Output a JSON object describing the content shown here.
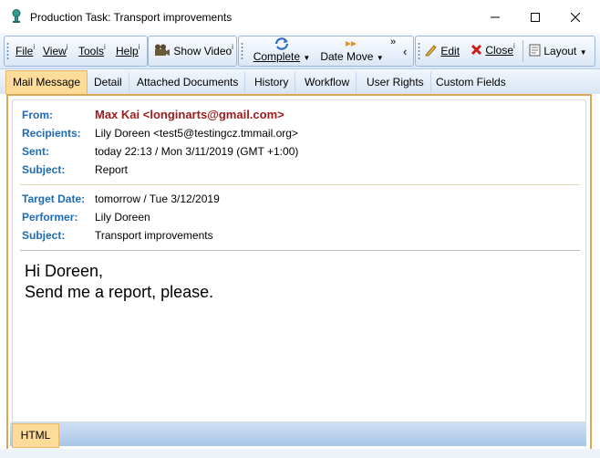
{
  "window": {
    "title": "Production Task: Transport improvements",
    "app_icon": "pin-icon",
    "controls": {
      "minimize": "—",
      "maximize": "☐",
      "close": "✕"
    }
  },
  "toolbar": {
    "file": "File",
    "view": "View",
    "tools": "Tools",
    "help": "Help",
    "info_mark": "i",
    "show_video": "Show Video",
    "complete": "Complete",
    "date_move": "Date Move",
    "edit": "Edit",
    "close": "Close",
    "layout": "Layout",
    "overflow": "»",
    "collapse": "‹"
  },
  "tabs": [
    "Mail Message",
    "Detail",
    "Attached Documents",
    "History",
    "Workflow",
    "User Rights",
    "Custom Fields"
  ],
  "active_tab": "Mail Message",
  "message": {
    "from_label": "From:",
    "from_value": "Max Kai <longinarts@gmail.com>",
    "recipients_label": "Recipients:",
    "recipients_value": "Lily Doreen <test5@testingcz.tmmail.org>",
    "sent_label": "Sent:",
    "sent_value": "today 22:13 / Mon 3/11/2019 (GMT +1:00)",
    "subject_label": "Subject:",
    "subject_value": "Report"
  },
  "task": {
    "target_date_label": "Target Date:",
    "target_date_value": "tomorrow / Tue 3/12/2019",
    "performer_label": "Performer:",
    "performer_value": "Lily Doreen",
    "subject_label": "Subject:",
    "subject_value": "Transport improvements"
  },
  "body": {
    "line1": "Hi Doreen,",
    "line2": "Send me a report, please."
  },
  "bottom_tab": "HTML",
  "colors": {
    "label_blue": "#1c6bb4",
    "from_red": "#9b1c1c",
    "active_tab": "#fddc9a",
    "frame_border": "#e1a555"
  }
}
